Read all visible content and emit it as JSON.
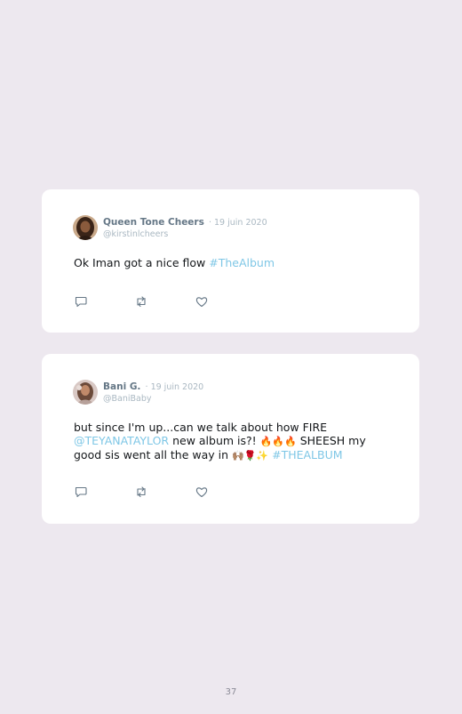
{
  "tweets": [
    {
      "name": "Queen Tone Cheers",
      "date": "· 19 juin 2020",
      "handle": "@kirstinlcheers",
      "text_plain": "Ok Iman got a nice flow ",
      "hashtag": "#TheAlbum"
    },
    {
      "name": "Bani G.",
      "date": "· 19 juin 2020",
      "handle": "@BaniBaby",
      "text_1": "but since I'm up...can we talk about how FIRE ",
      "mention": "@TEYANATAYLOR",
      "text_2": " new album is?! ",
      "emoji_fire": "🔥🔥🔥",
      "text_3": " SHEESH my good sis went all the way in ",
      "emoji_2": "🙌🏽🌹✨",
      "hashtag": "#THEALBUM"
    }
  ],
  "page_number": "37",
  "icons": [
    "reply-icon",
    "retweet-icon",
    "like-icon"
  ],
  "colors": {
    "background": "#ede8ef",
    "card": "#ffffff",
    "link": "#7fc7e6",
    "name": "#657786",
    "muted": "#aab8c2"
  }
}
